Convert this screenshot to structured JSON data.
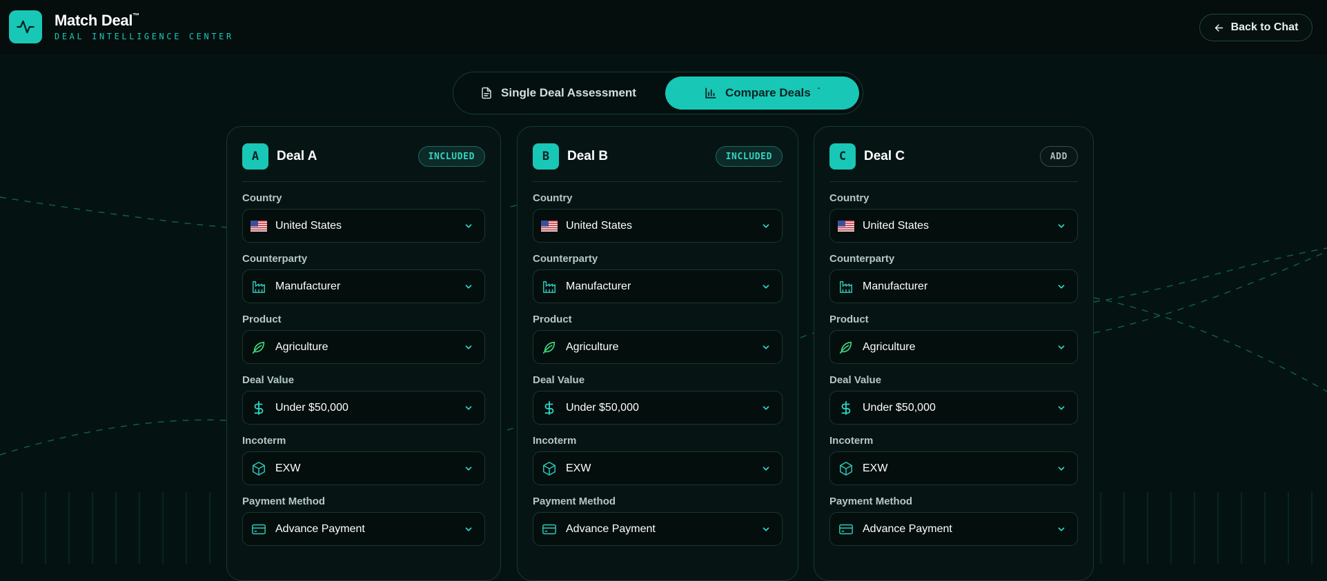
{
  "app": {
    "name": "Match Deal",
    "trademark": "™",
    "subtitle": "DEAL INTELLIGENCE CENTER",
    "back_label": "Back to Chat"
  },
  "tabs": [
    {
      "label": "Single Deal Assessment",
      "icon": "document-icon",
      "active": false
    },
    {
      "label": "Compare Deals",
      "icon": "bar-chart-icon",
      "active": true,
      "suffix": "ˇ"
    }
  ],
  "deals": [
    {
      "letter": "A",
      "title": "Deal A",
      "status": "INCLUDED",
      "fields": [
        {
          "label": "Country",
          "value": "United States",
          "icon": "us-flag-icon"
        },
        {
          "label": "Counterparty",
          "value": "Manufacturer",
          "icon": "factory-icon"
        },
        {
          "label": "Product",
          "value": "Agriculture",
          "icon": "leaf-icon"
        },
        {
          "label": "Deal Value",
          "value": "Under $50,000",
          "icon": "dollar-icon"
        },
        {
          "label": "Incoterm",
          "value": "EXW",
          "icon": "box-icon"
        },
        {
          "label": "Payment Method",
          "value": "Advance Payment",
          "icon": "credit-card-icon"
        }
      ]
    },
    {
      "letter": "B",
      "title": "Deal B",
      "status": "INCLUDED",
      "fields": [
        {
          "label": "Country",
          "value": "United States",
          "icon": "us-flag-icon"
        },
        {
          "label": "Counterparty",
          "value": "Manufacturer",
          "icon": "factory-icon"
        },
        {
          "label": "Product",
          "value": "Agriculture",
          "icon": "leaf-icon"
        },
        {
          "label": "Deal Value",
          "value": "Under $50,000",
          "icon": "dollar-icon"
        },
        {
          "label": "Incoterm",
          "value": "EXW",
          "icon": "box-icon"
        },
        {
          "label": "Payment Method",
          "value": "Advance Payment",
          "icon": "credit-card-icon"
        }
      ]
    },
    {
      "letter": "C",
      "title": "Deal C",
      "status": "ADD",
      "fields": [
        {
          "label": "Country",
          "value": "United States",
          "icon": "us-flag-icon"
        },
        {
          "label": "Counterparty",
          "value": "Manufacturer",
          "icon": "factory-icon"
        },
        {
          "label": "Product",
          "value": "Agriculture",
          "icon": "leaf-icon"
        },
        {
          "label": "Deal Value",
          "value": "Under $50,000",
          "icon": "dollar-icon"
        },
        {
          "label": "Incoterm",
          "value": "EXW",
          "icon": "box-icon"
        },
        {
          "label": "Payment Method",
          "value": "Advance Payment",
          "icon": "credit-card-icon"
        }
      ]
    }
  ],
  "colors": {
    "accent": "#19c7b6",
    "background": "#041312",
    "card": "#061514",
    "leaf": "#3ed07a"
  }
}
